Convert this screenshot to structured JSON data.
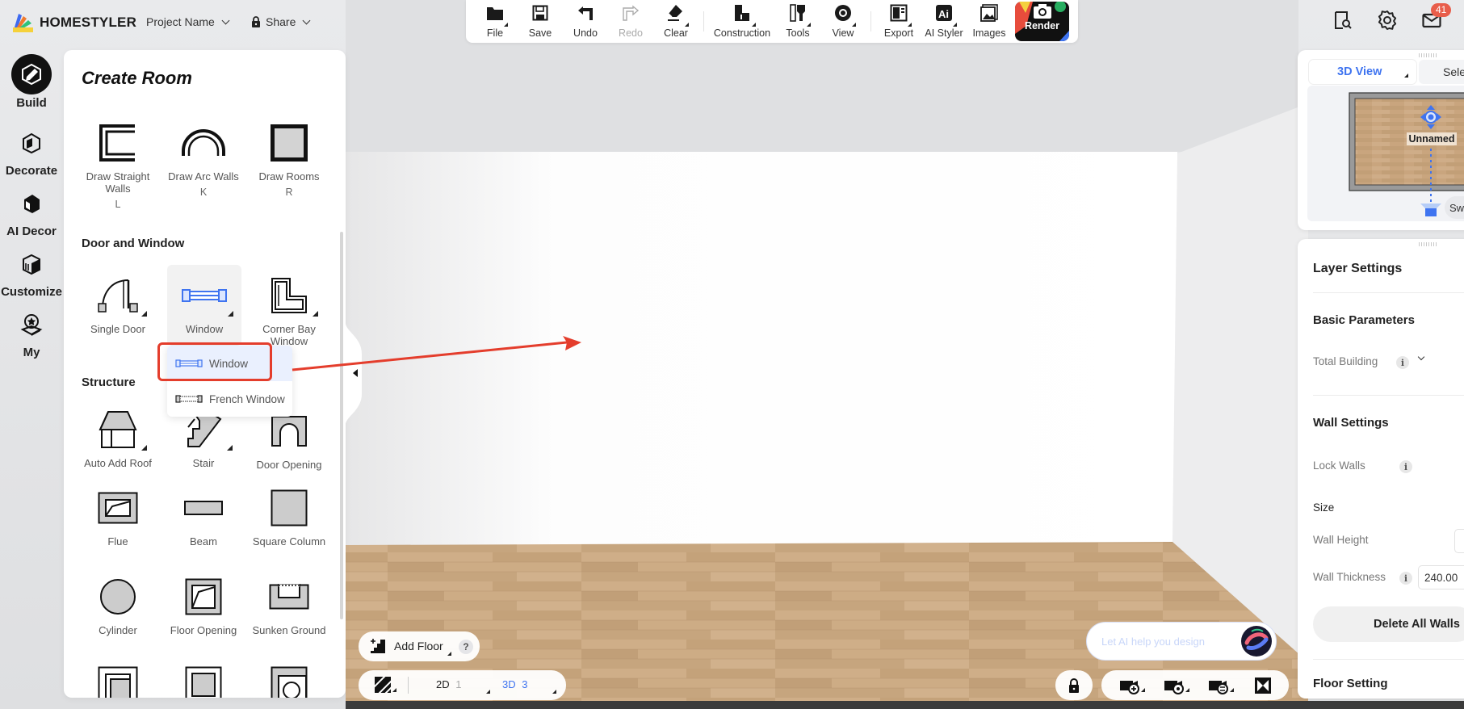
{
  "app": {
    "brand": "HOMESTYLER"
  },
  "header": {
    "project_name": "Project Name",
    "share": "Share",
    "notifications_count": "41"
  },
  "toolbar": {
    "items": [
      {
        "label": "File",
        "icon": "folder-icon"
      },
      {
        "label": "Save",
        "icon": "floppy-disk-icon"
      },
      {
        "label": "Undo",
        "icon": "undo-icon"
      },
      {
        "label": "Redo",
        "icon": "redo-icon",
        "disabled": true
      },
      {
        "label": "Clear",
        "icon": "eraser-icon"
      },
      {
        "label": "Construction",
        "icon": "construction-icon"
      },
      {
        "label": "Tools",
        "icon": "tools-icon"
      },
      {
        "label": "View",
        "icon": "eye-icon"
      },
      {
        "label": "Export",
        "icon": "export-icon"
      },
      {
        "label": "AI Styler",
        "icon": "ai-styler-icon"
      },
      {
        "label": "Images",
        "icon": "images-icon"
      },
      {
        "label": "Render",
        "icon": "camera-icon"
      }
    ]
  },
  "rail": {
    "items": [
      {
        "label": "Build",
        "active": true
      },
      {
        "label": "Decorate"
      },
      {
        "label": "AI Decor"
      },
      {
        "label": "Customize"
      },
      {
        "label": "My"
      }
    ]
  },
  "left_panel": {
    "title": "Create Room",
    "create_room": [
      {
        "label": "Draw Straight Walls",
        "key": "L"
      },
      {
        "label": "Draw Arc Walls",
        "key": "K"
      },
      {
        "label": "Draw Rooms",
        "key": "R"
      }
    ],
    "door_window_title": "Door and Window",
    "door_window": [
      {
        "label": "Single Door"
      },
      {
        "label": "Window"
      },
      {
        "label": "Corner Bay Window"
      }
    ],
    "structure_title": "Structure",
    "structure": [
      {
        "label": "Auto Add Roof"
      },
      {
        "label": "Stair"
      },
      {
        "label": "Door Opening"
      },
      {
        "label": "Flue"
      },
      {
        "label": "Beam"
      },
      {
        "label": "Square Column"
      },
      {
        "label": "Cylinder"
      },
      {
        "label": "Floor Opening"
      },
      {
        "label": "Sunken Ground"
      }
    ]
  },
  "window_popup": {
    "items": [
      {
        "label": "Window",
        "selected": true
      },
      {
        "label": "French Window"
      }
    ]
  },
  "view_panel": {
    "tab_active": "3D View",
    "tab_other": "Sele",
    "room_label": "Unnamed",
    "switch_label": "Switch"
  },
  "settings_panel": {
    "layer_settings": "Layer Settings",
    "basic_parameters": "Basic Parameters",
    "total_building": "Total Building",
    "wall_settings": "Wall Settings",
    "lock_walls": "Lock Walls",
    "size": "Size",
    "wall_height": "Wall Height",
    "wall_thickness": "Wall Thickness",
    "wall_thickness_value": "240.00",
    "delete_all_walls": "Delete All Walls",
    "floor_setting": "Floor Setting"
  },
  "bottom": {
    "add_floor": "Add Floor",
    "help": "?",
    "view_2d": "2D",
    "view_2d_num": "1",
    "view_3d": "3D",
    "view_3d_num": "3",
    "ai_placeholder": "Let AI help you design"
  },
  "colors": {
    "accent_blue": "#3f74f0",
    "annotation_red": "#e43d2c",
    "badge_red": "#e85d4a"
  }
}
